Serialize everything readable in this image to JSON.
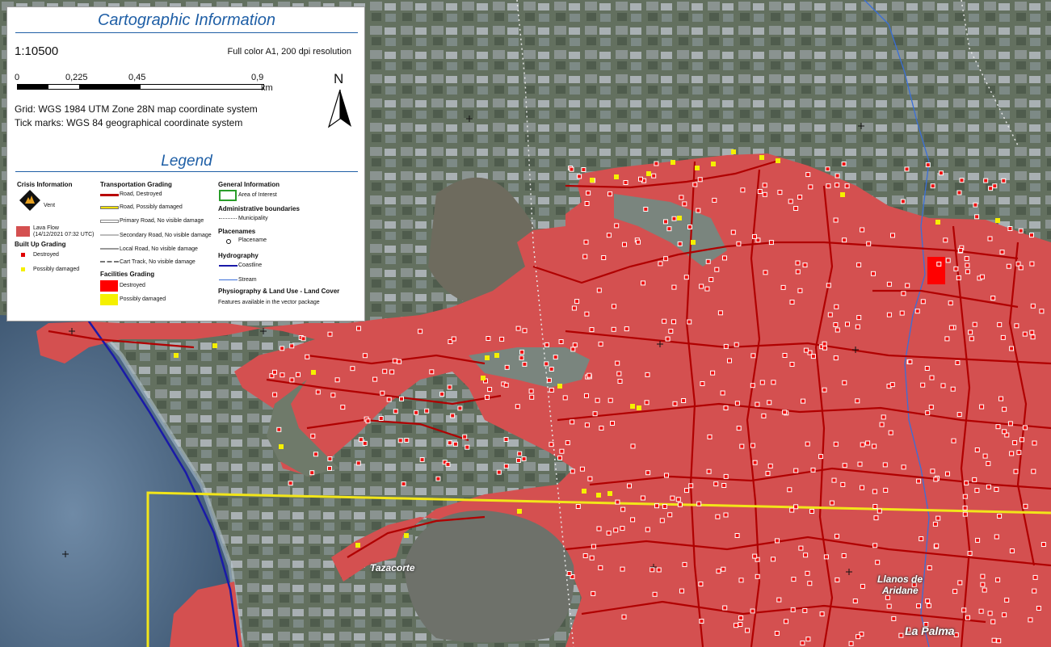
{
  "panel": {
    "title": "Cartographic Information",
    "scale": "1:10500",
    "print_info": "Full color A1, 200 dpi resolution",
    "scalebar": {
      "ticks": [
        "0",
        "0,225",
        "0,45",
        "0,9"
      ],
      "unit": "km"
    },
    "north": "N",
    "grid_text": "Grid: WGS 1984 UTM Zone 28N map coordinate system",
    "tick_text": "Tick marks: WGS 84 geographical coordinate system"
  },
  "legend": {
    "title": "Legend",
    "crisis": {
      "header": "Crisis Information",
      "vent": "Vent",
      "lava_flow": "Lava Flow",
      "lava_date": "(14/12/2021 07:32 UTC)"
    },
    "builtup": {
      "header": "Built Up Grading",
      "destroyed": "Destroyed",
      "possibly": "Possibly damaged"
    },
    "transport": {
      "header": "Transportation Grading",
      "items": [
        "Road, Destroyed",
        "Road, Possibly damaged",
        "Primary Road, No visible damage",
        "Secondary Road, No visible damage",
        "Local Road, No visible damage",
        "Cart Track, No visible damage"
      ]
    },
    "facilities": {
      "header": "Facilities Grading",
      "destroyed": "Destroyed",
      "possibly": "Possibly damaged"
    },
    "general": {
      "header": "General Information",
      "aoi": "Area of Interest"
    },
    "admin": {
      "header": "Administrative boundaries",
      "municipality": "Municipality"
    },
    "placenames": {
      "header": "Placenames",
      "placename": "Placename"
    },
    "hydro": {
      "header": "Hydrography",
      "coastline": "Coastline",
      "stream": "Stream"
    },
    "physio": {
      "header": "Physiography & Land Use - Land Cover",
      "note": "Features available in the vector package"
    }
  },
  "places": {
    "tazacorte": "Tazacorte",
    "llanos_line1": "Llanos de",
    "llanos_line2": "Aridane",
    "la_palma": "La Palma"
  },
  "colors": {
    "lava": "#d45050",
    "road_destroyed": "#b80000",
    "aoi": "#f2e51a",
    "coast": "#1a1aa8",
    "stream": "#3a6fd8",
    "sea": "#4c6a86",
    "land": "#6f7a6a",
    "panel_title": "#1f5fa6"
  }
}
